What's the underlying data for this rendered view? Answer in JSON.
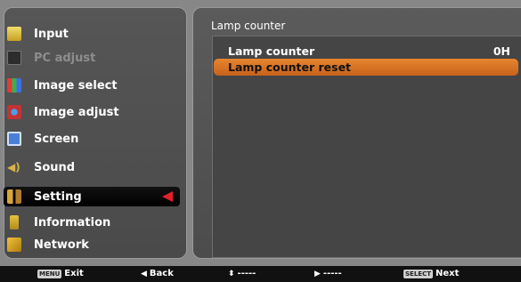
{
  "menu": {
    "items": [
      {
        "label": "Input",
        "icon": "input-icon",
        "state": "normal",
        "color": "#e8c846"
      },
      {
        "label": "PC adjust",
        "icon": "pc-adjust-icon",
        "state": "disabled",
        "color": "#333"
      },
      {
        "label": "Image select",
        "icon": "image-select-icon",
        "state": "normal",
        "color": "#d64b3a"
      },
      {
        "label": "Image adjust",
        "icon": "image-adjust-icon",
        "state": "normal",
        "color": "#c23a3a"
      },
      {
        "label": "Screen",
        "icon": "screen-icon",
        "state": "normal",
        "color": "#4b7fd6"
      },
      {
        "label": "Sound",
        "icon": "sound-icon",
        "state": "normal",
        "color": "#d8b34a"
      },
      {
        "label": "Setting",
        "icon": "setting-icon",
        "state": "selected",
        "color": "#c9952f"
      },
      {
        "label": "Information",
        "icon": "information-icon",
        "state": "normal",
        "color": "#e6c23a"
      },
      {
        "label": "Network",
        "icon": "network-icon",
        "state": "normal",
        "color": "#e0b030"
      }
    ]
  },
  "panel": {
    "title": "Lamp counter",
    "rows": [
      {
        "label": "Lamp counter",
        "value": "0H"
      },
      {
        "label": "Lamp counter reset",
        "value": ""
      }
    ]
  },
  "bottom": {
    "exit_tag": "MENU",
    "exit_label": "Exit",
    "back_label": "Back",
    "updown_label": "-----",
    "right_label": "-----",
    "next_tag": "SELECT",
    "next_label": "Next"
  },
  "colors": {
    "highlight": "#e07a2a",
    "selected_arrow": "#e3202a"
  }
}
